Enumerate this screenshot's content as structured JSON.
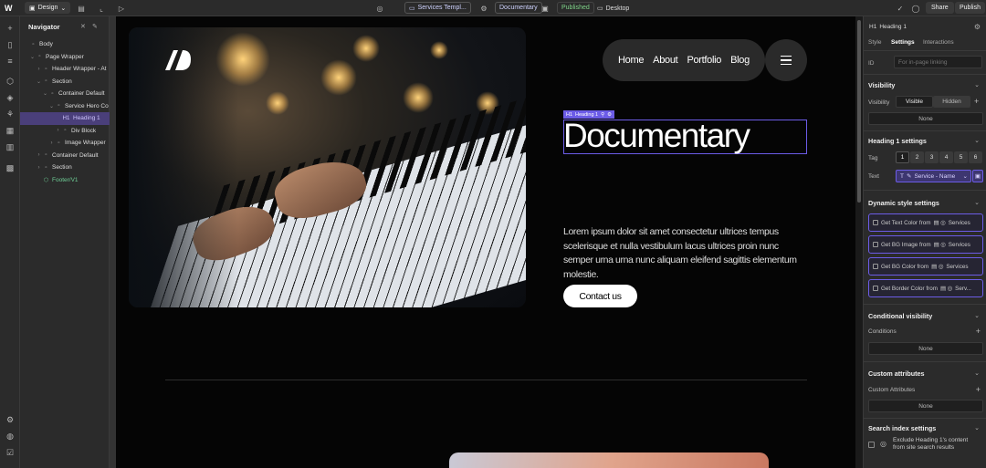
{
  "topbar": {
    "logo": "W",
    "mode": "Design",
    "page": "Services Templ...",
    "collection_item": "Documentary",
    "status": "Published",
    "breakpoint": "Desktop",
    "share": "Share",
    "publish": "Publish"
  },
  "navigator": {
    "title": "Navigator",
    "items": [
      {
        "label": "Body"
      },
      {
        "label": "Page Wrapper"
      },
      {
        "label": "Header Wrapper - At"
      },
      {
        "label": "Section"
      },
      {
        "label": "Container Default"
      },
      {
        "label": "Service Hero Co"
      },
      {
        "label": "Heading 1",
        "prefix": "H1"
      },
      {
        "label": "Div Block"
      },
      {
        "label": "Image Wrapper"
      },
      {
        "label": "Container Default"
      },
      {
        "label": "Section"
      },
      {
        "label": "Footer/V1"
      }
    ]
  },
  "canvas": {
    "nav_links": [
      "Home",
      "About",
      "Portfolio",
      "Blog"
    ],
    "selection_badge": "Heading 1",
    "selection_prefix": "H1",
    "heading": "Documentary",
    "paragraph": "Lorem ipsum dolor sit amet consectetur ultrices tempus scelerisque et nulla vestibulum lacus ultrices proin nunc semper urna urna nunc aliquam eleifend sagittis elementum molestie.",
    "cta": "Contact us"
  },
  "panel": {
    "element": "Heading 1",
    "element_prefix": "H1",
    "tabs": [
      "Style",
      "Settings",
      "Interactions"
    ],
    "id_label": "ID",
    "id_placeholder": "For in-page linking",
    "visibility": {
      "title": "Visibility",
      "label": "Visibility",
      "options": [
        "Visible",
        "Hidden"
      ],
      "value": "None"
    },
    "heading_settings": {
      "title": "Heading 1 settings",
      "tag_label": "Tag",
      "tags": [
        "1",
        "2",
        "3",
        "4",
        "5",
        "6"
      ],
      "text_label": "Text",
      "text_value": "Service - Name"
    },
    "dynamic_style": {
      "title": "Dynamic style settings",
      "items": [
        {
          "label": "Get Text Color from",
          "source": "Services"
        },
        {
          "label": "Get BG Image from",
          "source": "Services"
        },
        {
          "label": "Get BG Color from",
          "source": "Services"
        },
        {
          "label": "Get Border Color from",
          "source": "Serv..."
        }
      ]
    },
    "conditional": {
      "title": "Conditional visibility",
      "label": "Conditions",
      "value": "None"
    },
    "custom_attributes": {
      "title": "Custom attributes",
      "label": "Custom Attributes",
      "value": "None"
    },
    "search_index": {
      "title": "Search index settings",
      "exclude_line1": "Exclude Heading 1's content",
      "exclude_line2": "from site search results"
    }
  },
  "colors": {
    "accent": "#6c5ce7",
    "published": "#7fd389"
  }
}
